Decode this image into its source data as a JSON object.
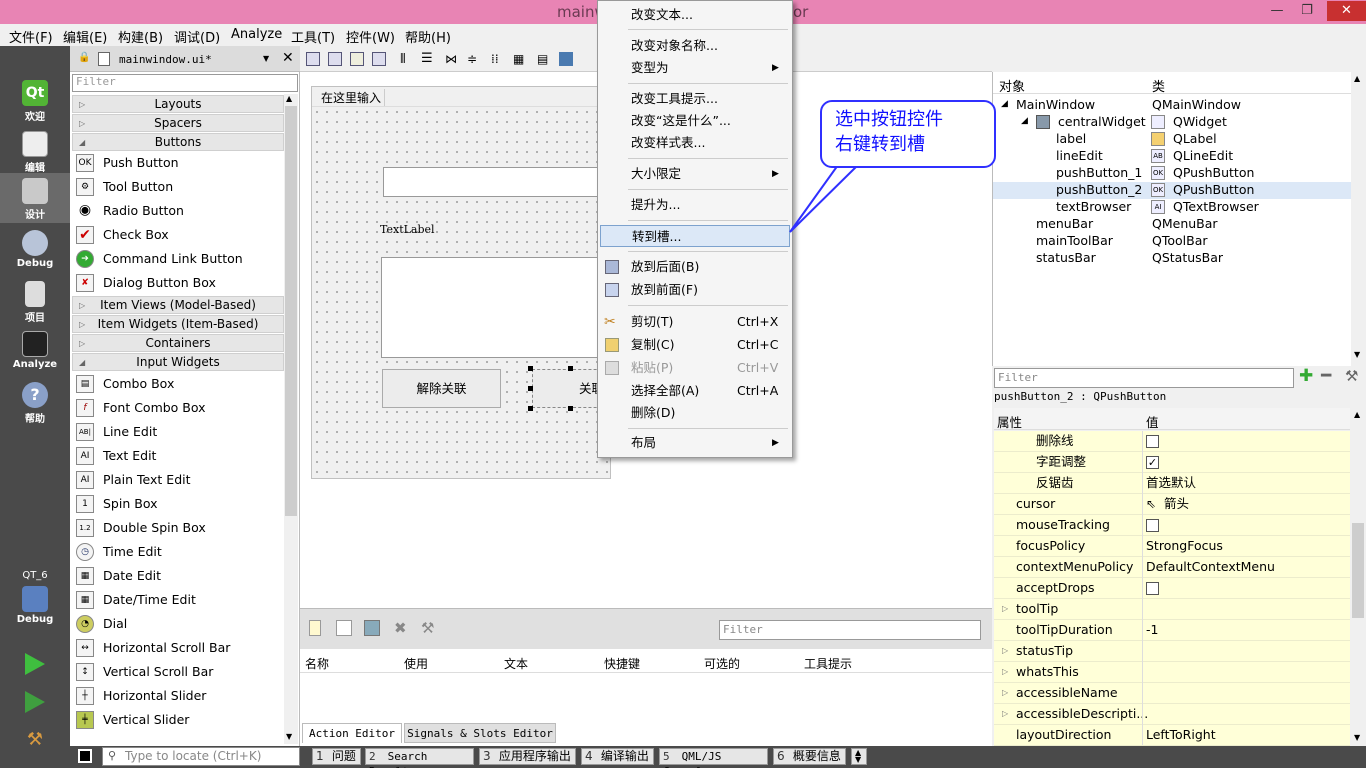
{
  "window": {
    "title_left": "mainw",
    "title_right": "or",
    "btn_min": "—",
    "btn_max": "❐",
    "btn_close": "✕"
  },
  "menubar": [
    "文件(F)",
    "编辑(E)",
    "构建(B)",
    "调试(D)",
    "Analyze",
    "工具(T)",
    "控件(W)",
    "帮助(H)"
  ],
  "modes": {
    "welcome": "欢迎",
    "edit": "编辑",
    "design": "设计",
    "debug": "Debug",
    "project": "项目",
    "analyze": "Analyze",
    "help": "帮助",
    "kit": "QT_6",
    "kit_mode": "Debug"
  },
  "editor_file": "mainwindow.ui*",
  "widget_box": {
    "filter_placeholder": "Filter",
    "categories": {
      "layouts": "Layouts",
      "spacers": "Spacers",
      "buttons": "Buttons",
      "item_views": "Item Views (Model-Based)",
      "item_widgets": "Item Widgets (Item-Based)",
      "containers": "Containers",
      "input_widgets": "Input Widgets"
    },
    "buttons": [
      "Push Button",
      "Tool Button",
      "Radio Button",
      "Check Box",
      "Command Link Button",
      "Dialog Button Box"
    ],
    "inputs": [
      "Combo Box",
      "Font Combo Box",
      "Line Edit",
      "Text Edit",
      "Plain Text Edit",
      "Spin Box",
      "Double Spin Box",
      "Time Edit",
      "Date Edit",
      "Date/Time Edit",
      "Dial",
      "Horizontal Scroll Bar",
      "Vertical Scroll Bar",
      "Horizontal Slider",
      "Vertical Slider"
    ]
  },
  "form": {
    "menu_placeholder": "在这里输入",
    "text_label": "TextLabel",
    "button1": "解除关联",
    "button2": "关联"
  },
  "action_editor": {
    "filter_placeholder": "Filter",
    "columns": [
      "名称",
      "使用",
      "文本",
      "快捷键",
      "可选的",
      "工具提示"
    ],
    "tabs": [
      "Action Editor",
      "Signals & Slots Editor"
    ]
  },
  "object_inspector": {
    "headers": [
      "对象",
      "类"
    ],
    "rows": [
      {
        "name": "MainWindow",
        "cls": "QMainWindow"
      },
      {
        "name": "centralWidget",
        "cls": "QWidget"
      },
      {
        "name": "label",
        "cls": "QLabel"
      },
      {
        "name": "lineEdit",
        "cls": "QLineEdit"
      },
      {
        "name": "pushButton_1",
        "cls": "QPushButton"
      },
      {
        "name": "pushButton_2",
        "cls": "QPushButton"
      },
      {
        "name": "textBrowser",
        "cls": "QTextBrowser"
      },
      {
        "name": "menuBar",
        "cls": "QMenuBar"
      },
      {
        "name": "mainToolBar",
        "cls": "QToolBar"
      },
      {
        "name": "statusBar",
        "cls": "QStatusBar"
      }
    ]
  },
  "property_editor": {
    "filter_placeholder": "Filter",
    "selected": "pushButton_2 : QPushButton",
    "headers": [
      "属性",
      "值"
    ],
    "rows": [
      {
        "name": "删除线",
        "value": ""
      },
      {
        "name": "字距调整",
        "value": ""
      },
      {
        "name": "反锯齿",
        "value": "首选默认"
      },
      {
        "name": "cursor",
        "value": "箭头"
      },
      {
        "name": "mouseTracking",
        "value": ""
      },
      {
        "name": "focusPolicy",
        "value": "StrongFocus"
      },
      {
        "name": "contextMenuPolicy",
        "value": "DefaultContextMenu"
      },
      {
        "name": "acceptDrops",
        "value": ""
      },
      {
        "name": "toolTip",
        "value": ""
      },
      {
        "name": "toolTipDuration",
        "value": "-1"
      },
      {
        "name": "statusTip",
        "value": ""
      },
      {
        "name": "whatsThis",
        "value": ""
      },
      {
        "name": "accessibleName",
        "value": ""
      },
      {
        "name": "accessibleDescripti...",
        "value": ""
      },
      {
        "name": "layoutDirection",
        "value": "LeftToRight"
      }
    ]
  },
  "context_menu": {
    "items": [
      {
        "label": "改变文本..."
      },
      {
        "label": "改变对象名称..."
      },
      {
        "label": "变型为",
        "submenu": "▶"
      },
      {
        "label": "改变工具提示..."
      },
      {
        "label": "改变“这是什么”..."
      },
      {
        "label": "改变样式表..."
      },
      {
        "label": "大小限定",
        "submenu": "▶"
      },
      {
        "label": "提升为..."
      },
      {
        "label": "转到槽..."
      },
      {
        "label": "放到后面(B)"
      },
      {
        "label": "放到前面(F)"
      },
      {
        "label": "剪切(T)",
        "shortcut": "Ctrl+X"
      },
      {
        "label": "复制(C)",
        "shortcut": "Ctrl+C"
      },
      {
        "label": "粘贴(P)",
        "shortcut": "Ctrl+V"
      },
      {
        "label": "选择全部(A)",
        "shortcut": "Ctrl+A"
      },
      {
        "label": "删除(D)"
      },
      {
        "label": "布局",
        "submenu": "▶"
      }
    ]
  },
  "callout": {
    "line1": "选中按钮控件",
    "line2": "右键转到槽"
  },
  "statusbar": {
    "locate_placeholder": "Type to locate (Ctrl+K)",
    "panes": [
      {
        "num": "1",
        "label": "问题"
      },
      {
        "num": "2",
        "label": "Search Results"
      },
      {
        "num": "3",
        "label": "应用程序输出"
      },
      {
        "num": "4",
        "label": "编译输出"
      },
      {
        "num": "5",
        "label": "QML/JS Console"
      },
      {
        "num": "6",
        "label": "概要信息"
      }
    ]
  },
  "colors": {
    "title_bar": "#e884b4",
    "mode_bar": "#4a4a4a",
    "highlight": "#dce8f7",
    "callout": "#1010ff",
    "property_row": "#ffffd8"
  }
}
